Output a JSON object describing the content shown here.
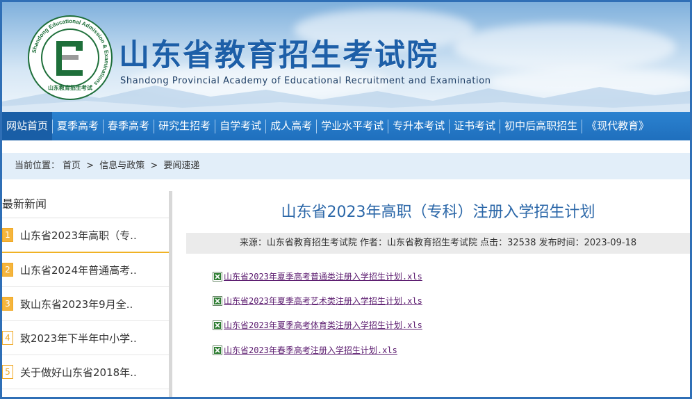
{
  "site": {
    "title_cn": "山东省教育招生考试院",
    "title_en": "Shandong Provincial Academy of Educational Recruitment and Examination",
    "logo_ring_text": "Shandong Educational Admission & Examinations",
    "logo_bottom_text": "山东教育招生考试"
  },
  "nav": {
    "items": [
      "网站首页",
      "夏季高考",
      "春季高考",
      "研究生招考",
      "自学考试",
      "成人高考",
      "学业水平考试",
      "专升本考试",
      "证书考试",
      "初中后高职招生",
      "《现代教育》"
    ]
  },
  "breadcrumb": {
    "prefix": "当前位置：",
    "items": [
      "首页",
      ">",
      "信息与政策",
      ">",
      "要闻速递"
    ]
  },
  "sidebar": {
    "title": "最新新闻",
    "items": [
      {
        "num": "1",
        "label": "山东省2023年高职（专.."
      },
      {
        "num": "2",
        "label": "山东省2024年普通高考.."
      },
      {
        "num": "3",
        "label": "致山东省2023年9月全.."
      },
      {
        "num": "4",
        "label": "致2023年下半年中小学.."
      },
      {
        "num": "5",
        "label": "关于做好山东省2018年.."
      }
    ]
  },
  "article": {
    "title": "山东省2023年高职（专科）注册入学招生计划",
    "meta": "来源：山东省教育招生考试院 作者：山东省教育招生考试院 点击：32538 发布时间：2023-09-18",
    "files": [
      "山东省2023年夏季高考普通类注册入学招生计划.xls",
      "山东省2023年夏季高考艺术类注册入学招生计划.xls",
      "山东省2023年夏季高考体育类注册入学招生计划.xls",
      "山东省2023年春季高考注册入学招生计划.xls"
    ]
  },
  "colors": {
    "brand_blue": "#1d5fa8",
    "nav_blue": "#2878c8",
    "accent_orange": "#f0b224",
    "link_purple": "#5a1a6e"
  }
}
